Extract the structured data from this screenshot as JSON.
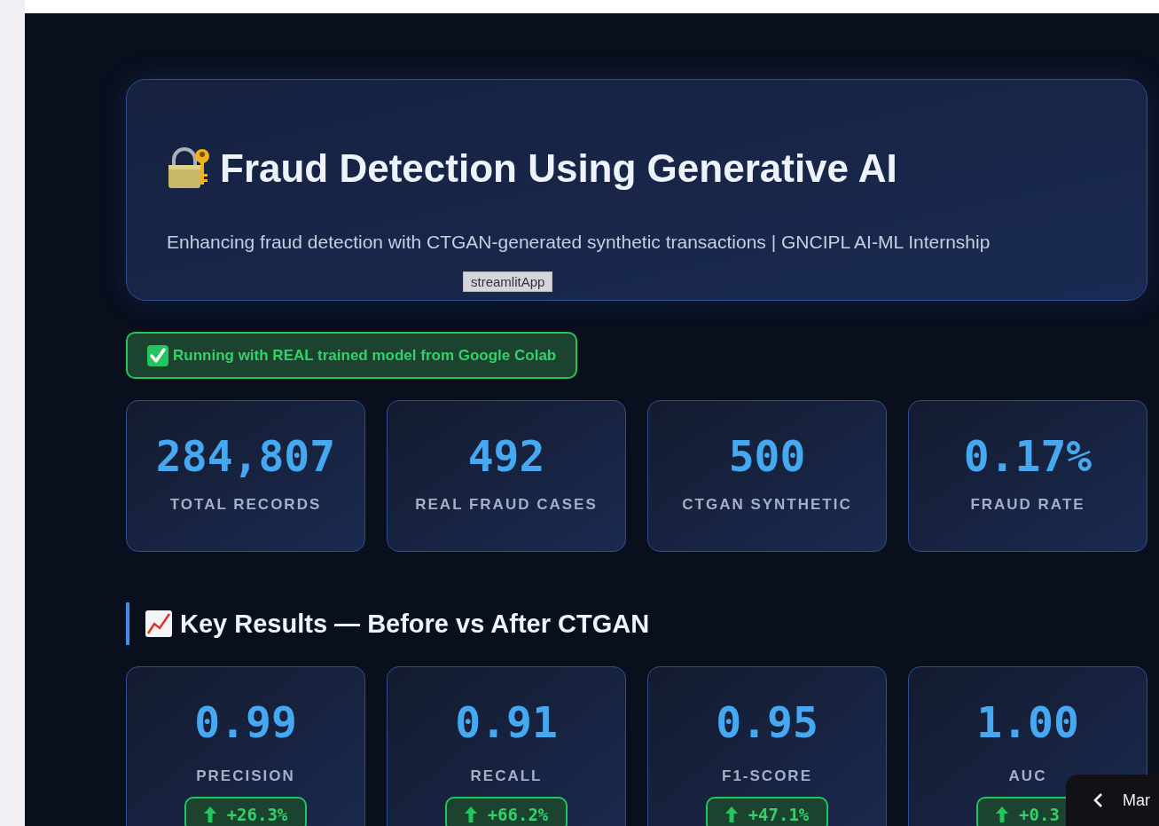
{
  "header": {
    "title": "Fraud Detection Using Generative AI",
    "subtitle": "Enhancing fraud detection with CTGAN-generated synthetic transactions | GNCIPL AI-ML Internship",
    "tooltip": "streamlitApp"
  },
  "status": {
    "kind": "success",
    "text": "Running with REAL trained model from Google Colab"
  },
  "stats": [
    {
      "value": "284,807",
      "label": "TOTAL RECORDS"
    },
    {
      "value": "492",
      "label": "REAL FRAUD CASES"
    },
    {
      "value": "500",
      "label": "CTGAN SYNTHETIC"
    },
    {
      "value": "0.17%",
      "label": "FRAUD RATE"
    }
  ],
  "section": {
    "title": "Key Results — Before vs After CTGAN"
  },
  "results": [
    {
      "value": "0.99",
      "label": "PRECISION",
      "delta": "+26.3%",
      "kind": "increase"
    },
    {
      "value": "0.91",
      "label": "RECALL",
      "delta": "+66.2%",
      "kind": "increase"
    },
    {
      "value": "0.95",
      "label": "F1-SCORE",
      "delta": "+47.1%",
      "kind": "increase"
    },
    {
      "value": "1.00",
      "label": "AUC",
      "delta": "+0.3",
      "kind": "increase"
    }
  ],
  "sidebar_toggle": {
    "label": "Mar"
  }
}
